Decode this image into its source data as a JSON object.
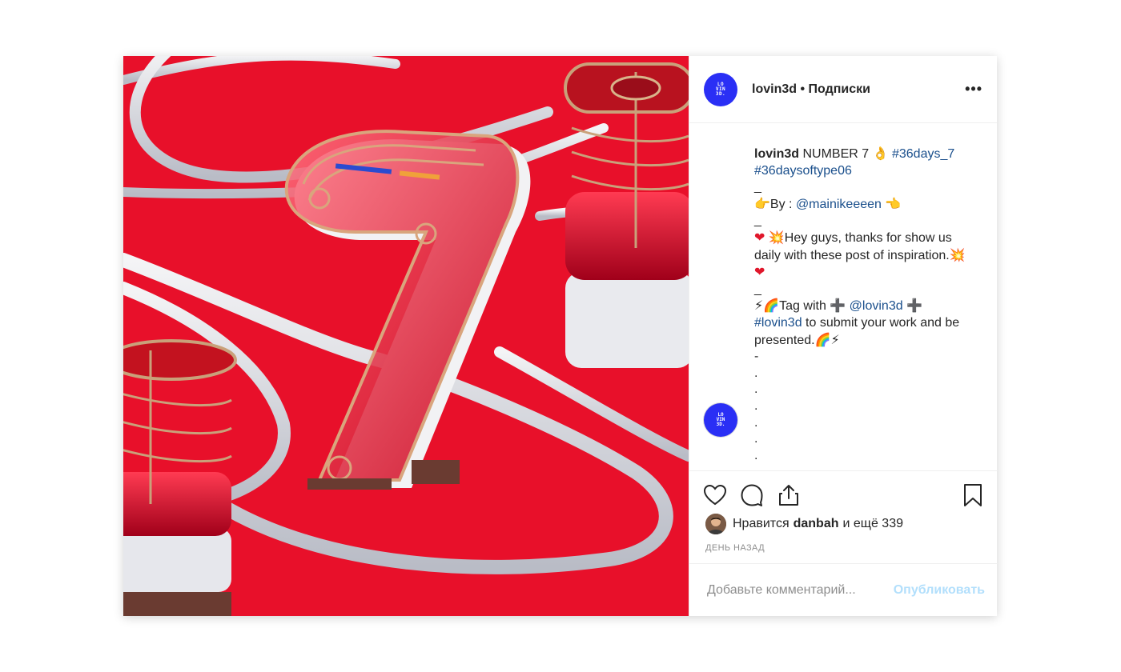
{
  "post": {
    "username": "lovin3d",
    "follow_status": "Подписки",
    "separator": " • ",
    "avatar_text": [
      "LO",
      "VIN",
      "3D."
    ],
    "more_glyph": "•••"
  },
  "caption": {
    "username": "lovin3d",
    "line1_text": "NUMBER 7",
    "line1_emoji": "👌",
    "hashtag1": "#36days_7",
    "hashtag2": "#36daysoftype06",
    "dash1": "_",
    "by_emoji": "👉",
    "by_text": "By : ",
    "mention1": "@mainikeeeen",
    "by_emoji_end": "👈",
    "dash2": "_",
    "hey_emoji1": "❤",
    "hey_emoji2": "💥",
    "hey_text_a": "Hey guys, thanks for show us",
    "hey_text_b": "daily with these post of inspiration.",
    "hey_emoji3": "💥",
    "hey_emoji4": "❤",
    "dash3": "_",
    "tag_emoji1": "⚡",
    "tag_emoji2": "🌈",
    "tag_text": "Tag with ",
    "plus_emoji": "➕",
    "mention2": "@lovin3d",
    "plus_emoji2": "➕",
    "hashtag3": "#lovin3d",
    "submit_text": " to submit your work and be",
    "presented_text": "presented.",
    "end_emoji1": "🌈",
    "end_emoji2": "⚡",
    "dash4": "-",
    "dots": [
      ".",
      ".",
      ".",
      ".",
      ".",
      "."
    ]
  },
  "likes": {
    "prefix": "Нравится",
    "user": "danbah",
    "suffix": "и ещё 339"
  },
  "date": "ДЕНЬ НАЗАД",
  "comment": {
    "placeholder": "Добавьте комментарий...",
    "publish_label": "Опубликовать"
  },
  "colors": {
    "photo_background": "#e8102a",
    "avatar": "#2a2ff5",
    "link": "#1a4f8c",
    "publish": "#b2dffc"
  },
  "icons": [
    "heart-icon",
    "comment-icon",
    "share-icon",
    "bookmark-icon",
    "more-icon"
  ]
}
